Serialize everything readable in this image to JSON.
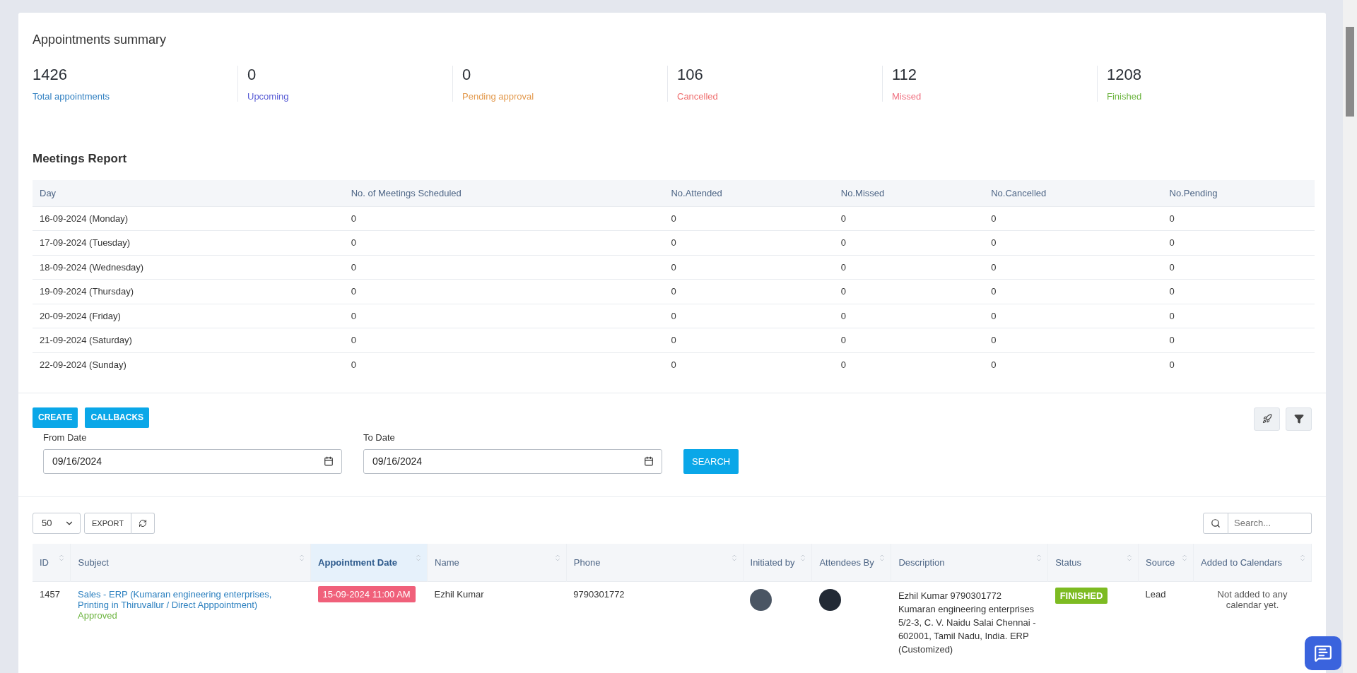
{
  "summary": {
    "title": "Appointments summary",
    "stats": [
      {
        "value": "1426",
        "label": "Total appointments",
        "color": "#2f7fc1"
      },
      {
        "value": "0",
        "label": "Upcoming",
        "color": "#5b5fd6"
      },
      {
        "value": "0",
        "label": "Pending approval",
        "color": "#e39a4e"
      },
      {
        "value": "106",
        "label": "Cancelled",
        "color": "#ef6f6f"
      },
      {
        "value": "112",
        "label": "Missed",
        "color": "#ef6f7f"
      },
      {
        "value": "1208",
        "label": "Finished",
        "color": "#6cb43f"
      }
    ]
  },
  "meetings_report": {
    "title": "Meetings Report",
    "columns": [
      "Day",
      "No. of Meetings Scheduled",
      "No.Attended",
      "No.Missed",
      "No.Cancelled",
      "No.Pending"
    ],
    "rows": [
      [
        "16-09-2024  (Monday)",
        "0",
        "0",
        "0",
        "0",
        "0"
      ],
      [
        "17-09-2024  (Tuesday)",
        "0",
        "0",
        "0",
        "0",
        "0"
      ],
      [
        "18-09-2024  (Wednesday)",
        "0",
        "0",
        "0",
        "0",
        "0"
      ],
      [
        "19-09-2024  (Thursday)",
        "0",
        "0",
        "0",
        "0",
        "0"
      ],
      [
        "20-09-2024  (Friday)",
        "0",
        "0",
        "0",
        "0",
        "0"
      ],
      [
        "21-09-2024  (Saturday)",
        "0",
        "0",
        "0",
        "0",
        "0"
      ],
      [
        "22-09-2024  (Sunday)",
        "0",
        "0",
        "0",
        "0",
        "0"
      ]
    ]
  },
  "toolbar": {
    "buttons": [
      "CREATE",
      "CALLBACKS"
    ],
    "from_date": {
      "label": "From Date",
      "value": "09/16/2024"
    },
    "to_date": {
      "label": "To Date",
      "value": "09/16/2024"
    },
    "search_button": "SEARCH"
  },
  "table_controls": {
    "page_size": "50",
    "export": "EXPORT",
    "search_placeholder": "Search..."
  },
  "appointments": {
    "columns": [
      {
        "label": "ID",
        "selected": false
      },
      {
        "label": "Subject",
        "selected": false
      },
      {
        "label": "Appointment Date",
        "selected": true
      },
      {
        "label": "Name",
        "selected": false
      },
      {
        "label": "Phone",
        "selected": false
      },
      {
        "label": "Initiated by",
        "selected": false
      },
      {
        "label": "Attendees By",
        "selected": false
      },
      {
        "label": "Description",
        "selected": false
      },
      {
        "label": "Status",
        "selected": false
      },
      {
        "label": "Source",
        "selected": false
      },
      {
        "label": "Added to Calendars",
        "selected": false
      }
    ],
    "rows": [
      {
        "id": "1457",
        "subject": "Sales - ERP (Kumaran engineering enterprises, Printing in Thiruvallur / Direct Apppointment)",
        "approval": "Approved",
        "date": "15-09-2024 11:00 AM",
        "name": "Ezhil Kumar",
        "phone": "9790301772",
        "description": "Ezhil Kumar 9790301772 Kumaran engineering enterprises 5/2-3, C. V. Naidu Salai Chennai - 602001, Tamil Nadu, India. ERP (Customized)",
        "status": "FINISHED",
        "source": "Lead",
        "calendar": "Not added to any calendar yet."
      }
    ]
  }
}
